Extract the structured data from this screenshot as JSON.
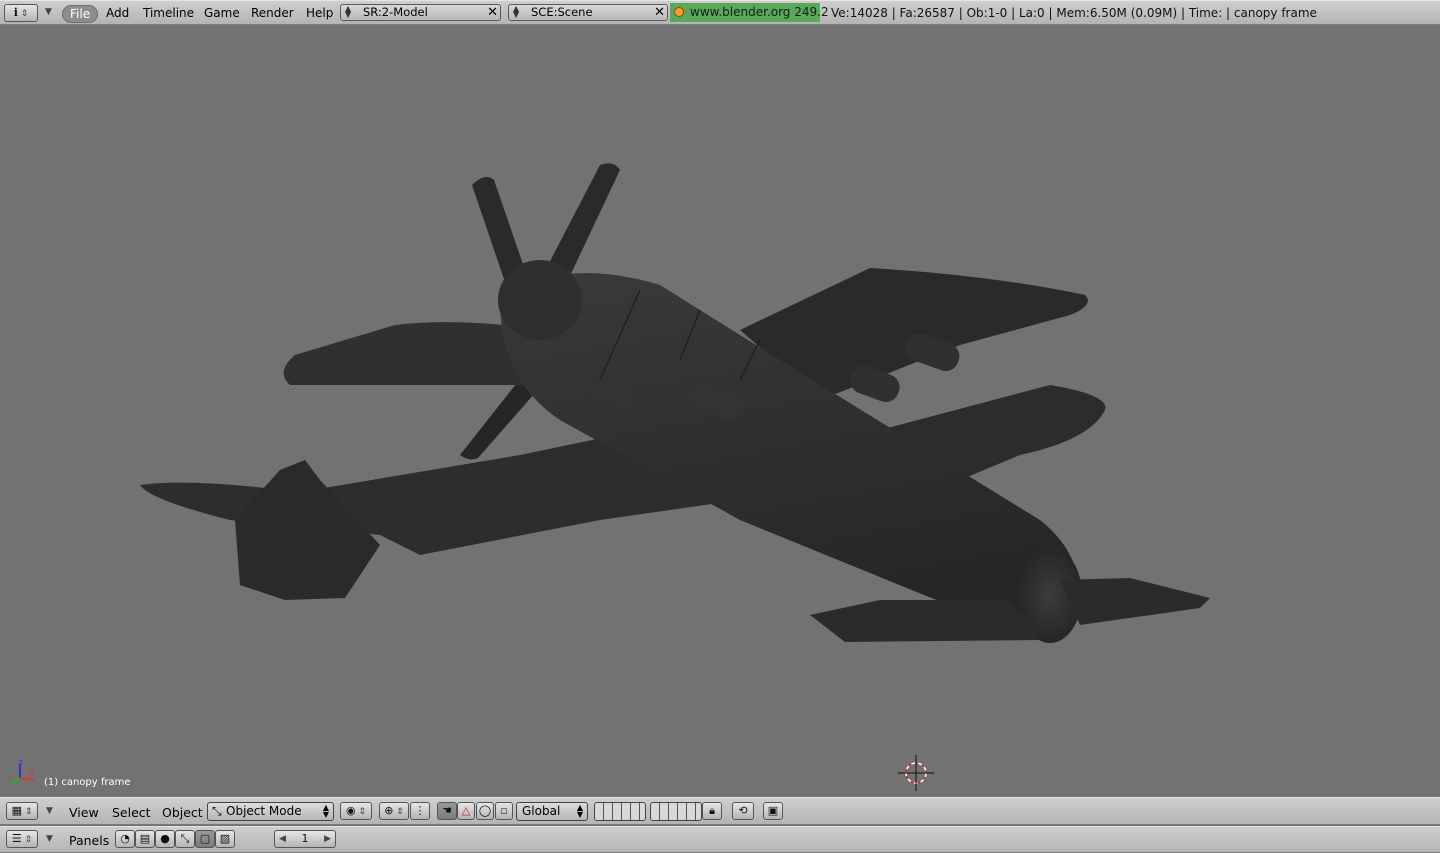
{
  "topbar": {
    "info_icon": "info-icon",
    "menus": [
      "File",
      "Add",
      "Timeline",
      "Game",
      "Render",
      "Help"
    ],
    "screen_field": "SR:2-Model",
    "scene_field": "SCE:Scene",
    "url_label": "www.blender.org 249.2",
    "stats": "Ve:14028 | Fa:26587 | Ob:1-0 | La:0  | Mem:6.50M (0.09M)  | Time: | canopy frame"
  },
  "viewport": {
    "object_label": "(1) canopy frame",
    "axis_labels": {
      "x": "x",
      "z": "z"
    },
    "background_color": "#727272",
    "model_color": "#2e2e2e"
  },
  "view_header": {
    "menus": [
      "View",
      "Select",
      "Object"
    ],
    "mode_select": "Object Mode",
    "orientation_select": "Global",
    "icons": [
      "grid-icon",
      "pivot-icon",
      "snap-magnet-icon",
      "manipulator-hand-icon",
      "translate-icon",
      "rotate-icon",
      "scale-icon",
      "layers-icon",
      "lock-icon",
      "occlusion-icon",
      "render-icon"
    ]
  },
  "buttons_header": {
    "panels_label": "Panels",
    "frame_number": "1",
    "icons": [
      "buttons-window-icon",
      "logic-icon",
      "script-icon",
      "shading-icon",
      "object-icon",
      "editing-icon",
      "scene-icon"
    ]
  }
}
